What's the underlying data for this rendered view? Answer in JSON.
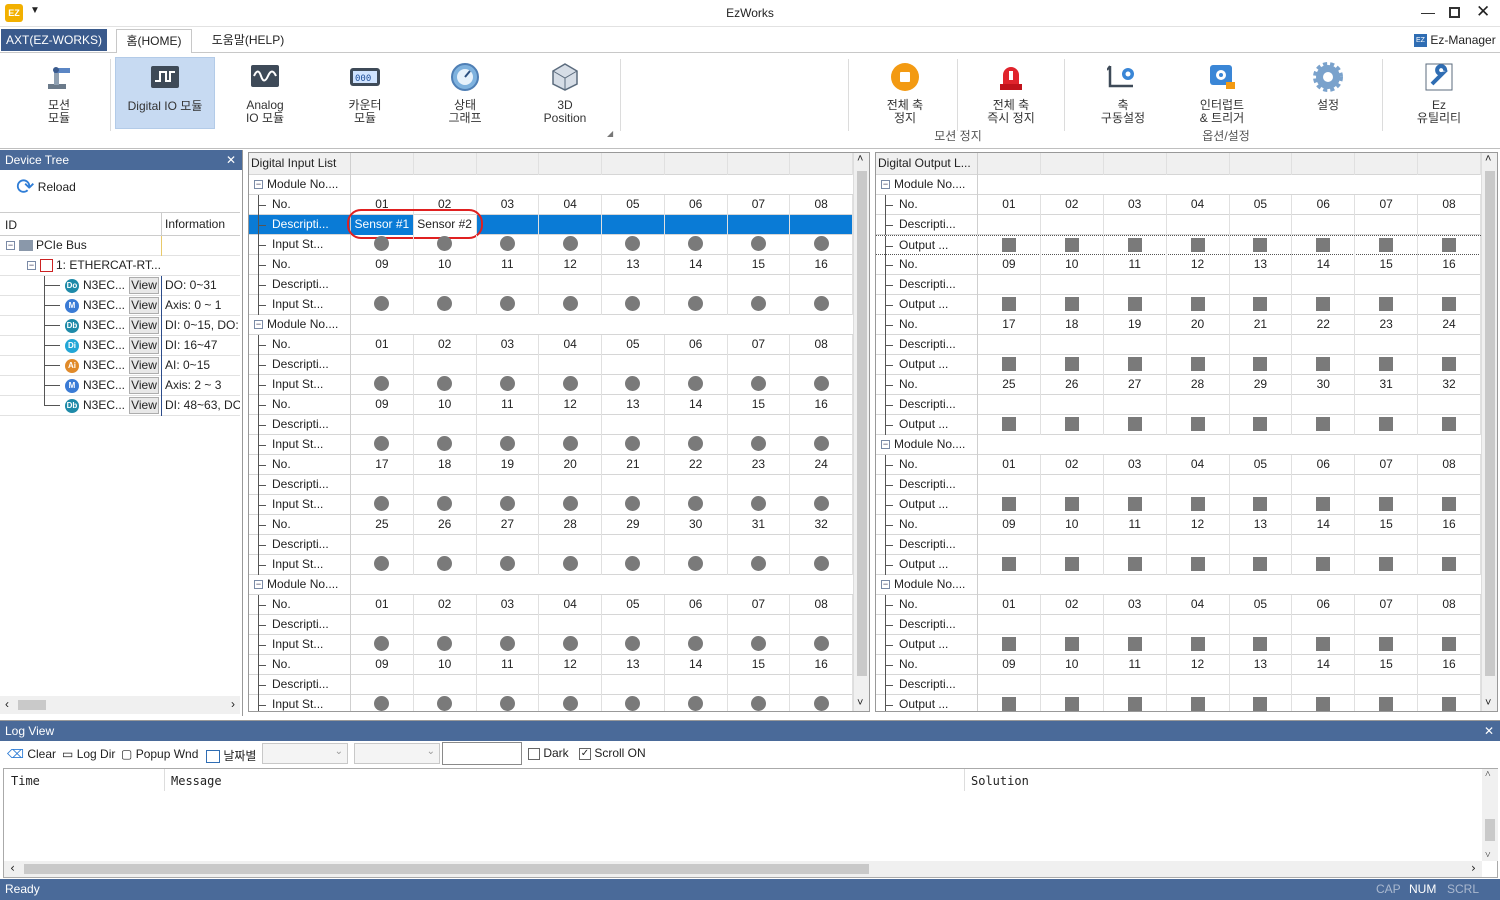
{
  "window": {
    "title": "EzWorks"
  },
  "tabs": {
    "app": "AXT(EZ-WORKS)",
    "home": "홈(HOME)",
    "help": "도움말(HELP)",
    "manager": "Ez-Manager"
  },
  "ribbon": {
    "motion": "모션\n모듈",
    "digital_io": "Digital IO 모듈",
    "analog": "Analog\nIO 모듈",
    "counter": "카운터\n모듈",
    "status": "상태\n그래프",
    "pos3d": "3D\nPosition",
    "stop_all": "전체 축\n정지",
    "estop_all": "전체 축\n즉시 정지",
    "axis_cfg": "축\n구동설정",
    "interrupt": "인터럽트\n& 트리거",
    "settings": "설정",
    "util": "Ez\n유틸리티",
    "group_stop": "모션 정지",
    "group_opt": "옵션/설정"
  },
  "device_tree": {
    "title": "Device Tree",
    "reload": "Reload",
    "col_id": "ID",
    "col_info": "Information",
    "bus": "PCIe Bus",
    "ethercat": "1: ETHERCAT-RT...",
    "view_label": "View",
    "nodes": [
      {
        "badge": "Do",
        "color": "#1e8aa8",
        "name": "N3EC...",
        "info": "DO: 0~31"
      },
      {
        "badge": "M",
        "color": "#3a7bd5",
        "name": "N3EC...",
        "info": "Axis: 0 ~ 1"
      },
      {
        "badge": "Db",
        "color": "#1e8aa8",
        "name": "N3EC...",
        "info": "DI: 0~15, DO:"
      },
      {
        "badge": "Di",
        "color": "#22a6d6",
        "name": "N3EC...",
        "info": "DI: 16~47"
      },
      {
        "badge": "Ai",
        "color": "#e08a2a",
        "name": "N3EC...",
        "info": "AI: 0~15"
      },
      {
        "badge": "M",
        "color": "#3a7bd5",
        "name": "N3EC...",
        "info": "Axis: 2 ~ 3"
      },
      {
        "badge": "Db",
        "color": "#1e8aa8",
        "name": "N3EC...",
        "info": "DI: 48~63, DO"
      }
    ]
  },
  "di_list": {
    "title": "Digital Input List",
    "module_label": "Module No....",
    "no_label": "No.",
    "desc_label": "Descripti...",
    "state_label": "Input St...",
    "sensor1": "Sensor #1",
    "sensor2": "Sensor #2"
  },
  "do_list": {
    "title": "Digital Output L...",
    "module_label": "Module No....",
    "no_label": "No.",
    "desc_label": "Descripti...",
    "state_label": "Output ..."
  },
  "numbers": {
    "g1": [
      "01",
      "02",
      "03",
      "04",
      "05",
      "06",
      "07",
      "08"
    ],
    "g2": [
      "09",
      "10",
      "11",
      "12",
      "13",
      "14",
      "15",
      "16"
    ],
    "g3": [
      "17",
      "18",
      "19",
      "20",
      "21",
      "22",
      "23",
      "24"
    ],
    "g4": [
      "25",
      "26",
      "27",
      "28",
      "29",
      "30",
      "31",
      "32"
    ]
  },
  "log": {
    "title": "Log View",
    "clear": "Clear",
    "logdir": "Log Dir",
    "popup": "Popup Wnd",
    "bydate": "날짜별",
    "dark": "Dark",
    "scroll_on": "Scroll ON",
    "col_time": "Time",
    "col_message": "Message",
    "col_solution": "Solution"
  },
  "status": {
    "ready": "Ready",
    "cap": "CAP",
    "num": "NUM",
    "scrl": "SCRL"
  }
}
